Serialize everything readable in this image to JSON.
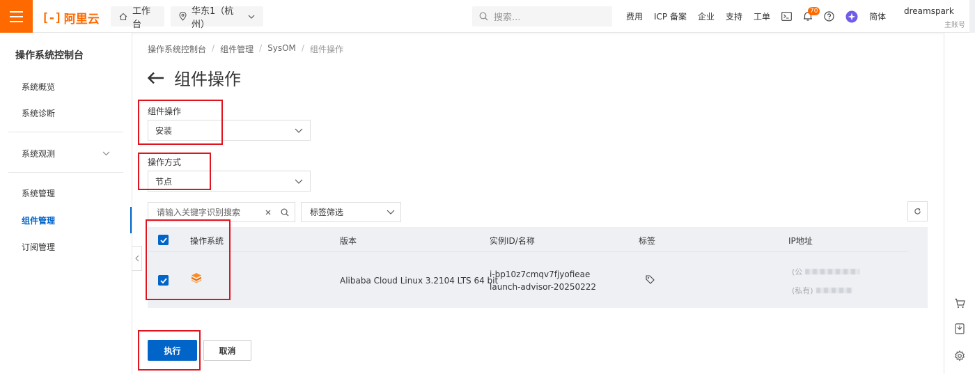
{
  "header": {
    "logo_text": "阿里云",
    "workbench": "工作台",
    "region": "华东1（杭州）",
    "search_placeholder": "搜索...",
    "links": [
      "费用",
      "ICP 备案",
      "企业",
      "支持",
      "工单"
    ],
    "notification_count": "70",
    "language": "简体",
    "username": "dreamspark",
    "account_role": "主账号"
  },
  "sidebar": {
    "title": "操作系统控制台",
    "items": [
      {
        "label": "系统概览"
      },
      {
        "label": "系统诊断"
      },
      {
        "label": "系统观测"
      },
      {
        "label": "系统管理"
      },
      {
        "label": "组件管理"
      },
      {
        "label": "订阅管理"
      }
    ],
    "active": "组件管理"
  },
  "breadcrumb": [
    "操作系统控制台",
    "组件管理",
    "SysOM",
    "组件操作"
  ],
  "page_title": "组件操作",
  "form": {
    "operation_label": "组件操作",
    "operation_value": "安装",
    "method_label": "操作方式",
    "method_value": "节点"
  },
  "filter": {
    "search_placeholder": "请输入关键字识别搜索",
    "tag_filter": "标签筛选"
  },
  "table": {
    "columns": [
      "操作系统",
      "版本",
      "实例ID/名称",
      "标签",
      "IP地址"
    ],
    "rows": [
      {
        "version": "Alibaba Cloud Linux  3.2104 LTS 64 bit",
        "instance_id": "i-bp10z7cmqv7fjyofieae",
        "instance_name": "launch-advisor-20250222",
        "ip_public_prefix": "(公",
        "ip_private_prefix": "(私有)"
      }
    ]
  },
  "actions": {
    "execute": "执行",
    "cancel": "取消"
  },
  "colors": {
    "brand": "#ff6a00",
    "primary": "#0064c8",
    "highlight": "#e0141e"
  }
}
